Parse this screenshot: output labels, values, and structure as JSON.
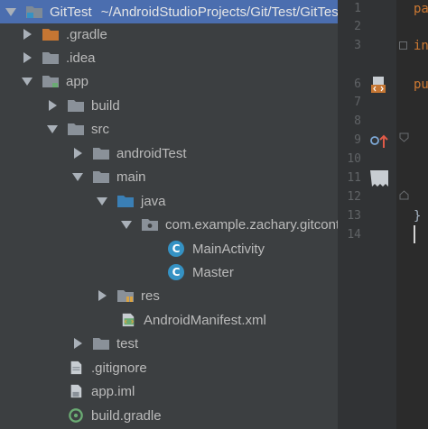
{
  "project": {
    "root": {
      "name": "GitTest",
      "path": "~/AndroidStudioProjects/Git/Test/GitTest"
    },
    "items": [
      {
        "label": ".gradle",
        "icon": "folder-orange-icon"
      },
      {
        "label": ".idea",
        "icon": "folder-icon"
      },
      {
        "label": "app",
        "icon": "module-folder-icon"
      },
      {
        "label": "build",
        "icon": "folder-icon"
      },
      {
        "label": "src",
        "icon": "folder-icon"
      },
      {
        "label": "androidTest",
        "icon": "folder-icon"
      },
      {
        "label": "main",
        "icon": "folder-icon"
      },
      {
        "label": "java",
        "icon": "source-folder-icon"
      },
      {
        "label": "com.example.zachary.gitcontrolproject",
        "icon": "package-icon"
      },
      {
        "label": "MainActivity",
        "icon": "class-icon"
      },
      {
        "label": "Master",
        "icon": "class-icon"
      },
      {
        "label": "res",
        "icon": "resources-folder-icon"
      },
      {
        "label": "AndroidManifest.xml",
        "icon": "manifest-icon"
      },
      {
        "label": "test",
        "icon": "folder-icon"
      },
      {
        "label": ".gitignore",
        "icon": "file-icon"
      },
      {
        "label": "app.iml",
        "icon": "iml-file-icon"
      },
      {
        "label": "build.gradle",
        "icon": "gradle-icon"
      }
    ]
  },
  "editor": {
    "line_numbers": [
      "1",
      "2",
      "3",
      "6",
      "7",
      "8",
      "9",
      "10",
      "11",
      "12",
      "13",
      "14"
    ],
    "code": {
      "line1": "pa",
      "line3": "in",
      "line6": "pu",
      "line13": "}"
    }
  },
  "colors": {
    "panel_bg": "#3c3f41",
    "selection": "#4b6eaf",
    "editor_bg": "#2b2b2b",
    "gutter_bg": "#313335",
    "class_icon": "#3592c4",
    "keyword": "#cc7832"
  }
}
